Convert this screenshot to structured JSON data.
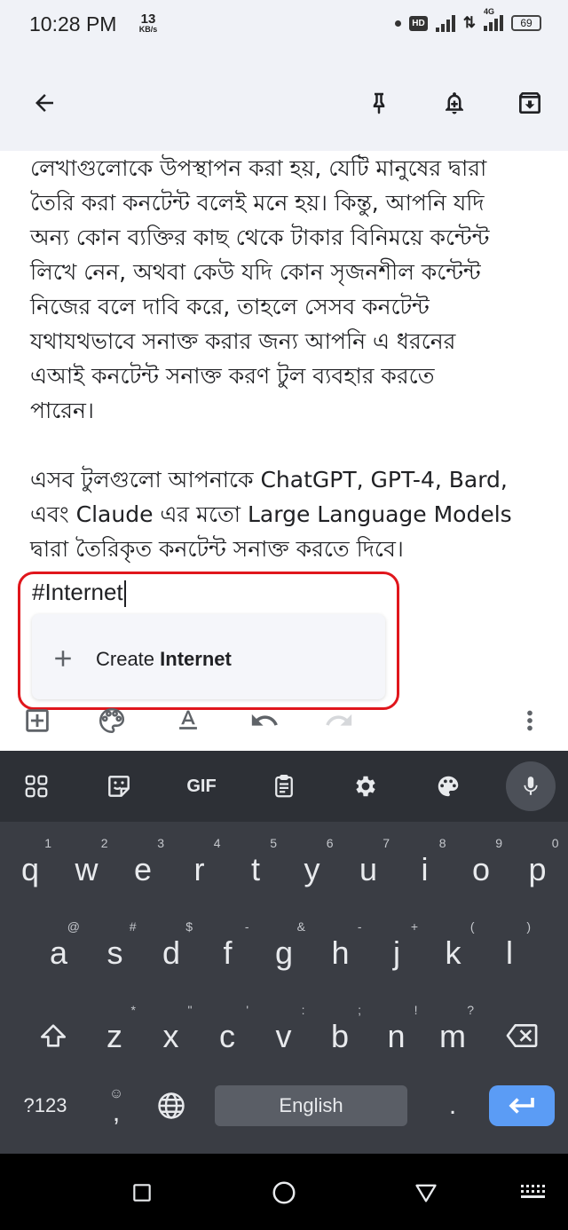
{
  "status_bar": {
    "time": "10:28 PM",
    "net_speed_value": "13",
    "net_speed_unit": "KB/s",
    "hd_badge": "HD",
    "network_type": "4G",
    "battery": "69"
  },
  "toolbar": {
    "back_icon": "arrow-left-icon",
    "pin_icon": "pin-icon",
    "reminder_icon": "bell-plus-icon",
    "archive_icon": "archive-icon"
  },
  "note": {
    "paragraph1": "লেখাগুলোকে উপস্থাপন করা হয়, যেটি মানুষের দ্বারা\nতৈরি করা কনটেন্ট বলেই মনে হয়। কিন্তু, আপনি যদি\nঅন্য কোন ব্যক্তির কাছ থেকে টাকার বিনিময়ে কন্টেন্ট\nলিখে নেন, অথবা কেউ যদি কোন সৃজনশীল কন্টেন্ট\nনিজের বলে দাবি করে, তাহলে সেসব কনটেন্ট\nযথাযথভাবে সনাক্ত করার জন্য আপনি এ ধরনের\nএআই কনটেন্ট সনাক্ত করণ টুল ব্যবহার করতে\nপারেন।",
    "paragraph2": "এসব টুলগুলো আপনাকে ChatGPT, GPT-4, Bard,\nএবং Claude এর মতো Large Language Models\nদ্বারা তৈরিকৃত কনটেন্ট সনাক্ত করতে দিবে।",
    "typed_tag": "#Internet"
  },
  "suggestion": {
    "prefix": "Create ",
    "label_name": "Internet"
  },
  "editor_bar": {
    "icons": [
      "add-box-icon",
      "palette-icon",
      "text-format-icon",
      "undo-icon",
      "redo-icon",
      "more-vert-icon"
    ]
  },
  "keyboard": {
    "toolbar": [
      "apps-grid-icon",
      "sticker-icon",
      "GIF",
      "clipboard-icon",
      "settings-gear-icon",
      "theme-palette-icon",
      "mic-icon"
    ],
    "row1": [
      {
        "k": "q",
        "s": "1"
      },
      {
        "k": "w",
        "s": "2"
      },
      {
        "k": "e",
        "s": "3"
      },
      {
        "k": "r",
        "s": "4"
      },
      {
        "k": "t",
        "s": "5"
      },
      {
        "k": "y",
        "s": "6"
      },
      {
        "k": "u",
        "s": "7"
      },
      {
        "k": "i",
        "s": "8"
      },
      {
        "k": "o",
        "s": "9"
      },
      {
        "k": "p",
        "s": "0"
      }
    ],
    "row2": [
      {
        "k": "a",
        "s": "@"
      },
      {
        "k": "s",
        "s": "#"
      },
      {
        "k": "d",
        "s": "$"
      },
      {
        "k": "f",
        "s": "-"
      },
      {
        "k": "g",
        "s": "&"
      },
      {
        "k": "h",
        "s": "-"
      },
      {
        "k": "j",
        "s": "+"
      },
      {
        "k": "k",
        "s": "("
      },
      {
        "k": "l",
        "s": ")"
      }
    ],
    "row3": [
      {
        "k": "z",
        "s": "*"
      },
      {
        "k": "x",
        "s": "\""
      },
      {
        "k": "c",
        "s": "'"
      },
      {
        "k": "v",
        "s": ":"
      },
      {
        "k": "b",
        "s": ";"
      },
      {
        "k": "n",
        "s": "!"
      },
      {
        "k": "m",
        "s": "?"
      }
    ],
    "symbols_key": "?123",
    "comma_key": ",",
    "emoji_hint": "☺",
    "space_label": "English",
    "period_key": "."
  },
  "nav_bar": {
    "icons": [
      "recents-square-icon",
      "home-circle-icon",
      "back-triangle-icon",
      "keyboard-switch-icon"
    ]
  }
}
